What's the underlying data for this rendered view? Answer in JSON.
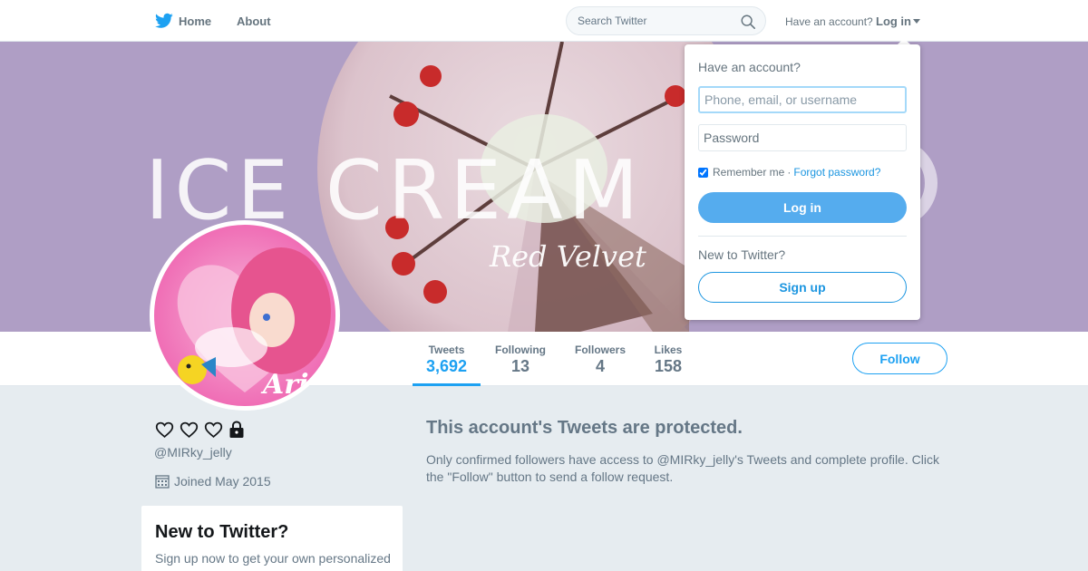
{
  "nav": {
    "home_label": "Home",
    "about_label": "About",
    "search_placeholder": "Search Twitter",
    "have_account": "Have an account?",
    "login_label": "Log in"
  },
  "profile": {
    "handle": "@MIRky_jelly",
    "joined": "Joined May 2015",
    "name_icons": [
      "heart-outline-icon",
      "heart-outline-icon",
      "heart-outline-icon",
      "lock-icon"
    ]
  },
  "banner": {
    "text": "ICE CREAM",
    "script_text": "Red Velvet"
  },
  "avatar": {
    "caption": "Ari"
  },
  "stats": [
    {
      "label": "Tweets",
      "value": "3,692",
      "active": true
    },
    {
      "label": "Following",
      "value": "13",
      "active": false
    },
    {
      "label": "Followers",
      "value": "4",
      "active": false
    },
    {
      "label": "Likes",
      "value": "158",
      "active": false
    }
  ],
  "follow_label": "Follow",
  "protected": {
    "title": "This account's Tweets are protected.",
    "text": "Only confirmed followers have access to @MIRky_jelly's Tweets and complete profile. Click the \"Follow\" button to send a follow request."
  },
  "new_card": {
    "title": "New to Twitter?",
    "text": "Sign up now to get your own personalized timeline!"
  },
  "login_dropdown": {
    "title": "Have an account?",
    "username_placeholder": "Phone, email, or username",
    "password_placeholder": "Password",
    "remember_label": "Remember me",
    "separator": "·",
    "forgot_label": "Forgot password?",
    "login_button": "Log in",
    "new_label": "New to Twitter?",
    "signup_button": "Sign up"
  },
  "colors": {
    "accent": "#1da1f2",
    "login_button": "#55acee",
    "background": "#e6ecf0",
    "banner": "#b3a3c8"
  }
}
